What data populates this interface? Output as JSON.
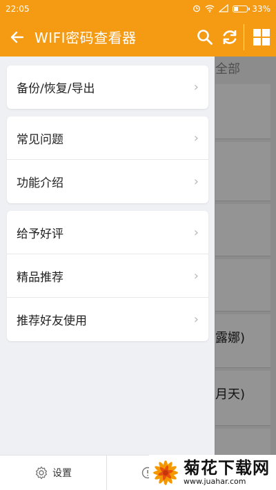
{
  "status": {
    "time": "22:05",
    "battery": "33%",
    "battery_level": 0.33
  },
  "toolbar": {
    "title": "WIFI密码查看器",
    "icons": [
      "back-arrow-icon",
      "search-icon",
      "refresh-icon",
      "grid-icon"
    ]
  },
  "underlay": {
    "tab": "全部",
    "rows": [
      "露娜)",
      "月天)"
    ]
  },
  "drawer": {
    "group1": [
      {
        "label": "备份/恢复/导出"
      }
    ],
    "group2": [
      {
        "label": "常见问题"
      },
      {
        "label": "功能介绍"
      }
    ],
    "group3": [
      {
        "label": "给予好评"
      },
      {
        "label": "精品推荐"
      },
      {
        "label": "推荐好友使用"
      }
    ]
  },
  "bottom": {
    "settings": "设置"
  },
  "watermark": {
    "brand": "菊花下载网",
    "url": "www.juahar.com"
  },
  "colors": {
    "accent": "#f49a13"
  }
}
